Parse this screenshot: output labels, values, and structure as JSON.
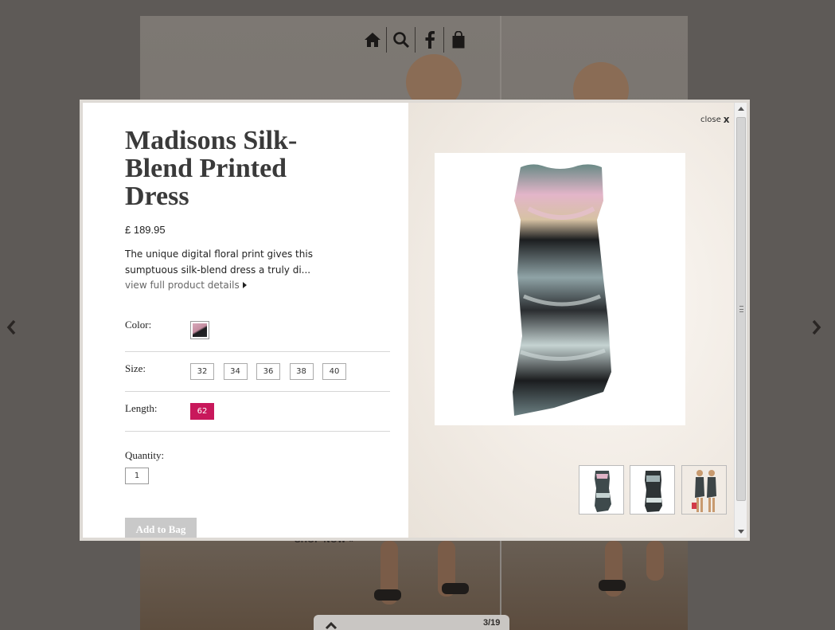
{
  "background": {
    "shop_now_label": "SHOP NOW »",
    "pager_count": "3/19"
  },
  "top_nav": {
    "icons": [
      "home-icon",
      "search-icon",
      "facebook-icon",
      "shopping-bag-icon"
    ]
  },
  "product": {
    "title": "Madisons Silk-Blend Printed Dress",
    "price": "£ 189.95",
    "description": "The unique digital floral print gives this sumptuous silk-blend dress a truly di...",
    "view_details_label": "view full product details",
    "color_label": "Color:",
    "size_label": "Size:",
    "sizes": [
      "32",
      "34",
      "36",
      "38",
      "40"
    ],
    "length_label": "Length:",
    "length_value": "62",
    "quantity_label": "Quantity:",
    "quantity_value": "1",
    "add_to_bag_label": "Add to Bag"
  },
  "modal": {
    "close_label": "close",
    "close_icon": "x"
  },
  "colors": {
    "accent_length": "#c8185b",
    "add_to_bag_bg": "#c9c9c9"
  }
}
